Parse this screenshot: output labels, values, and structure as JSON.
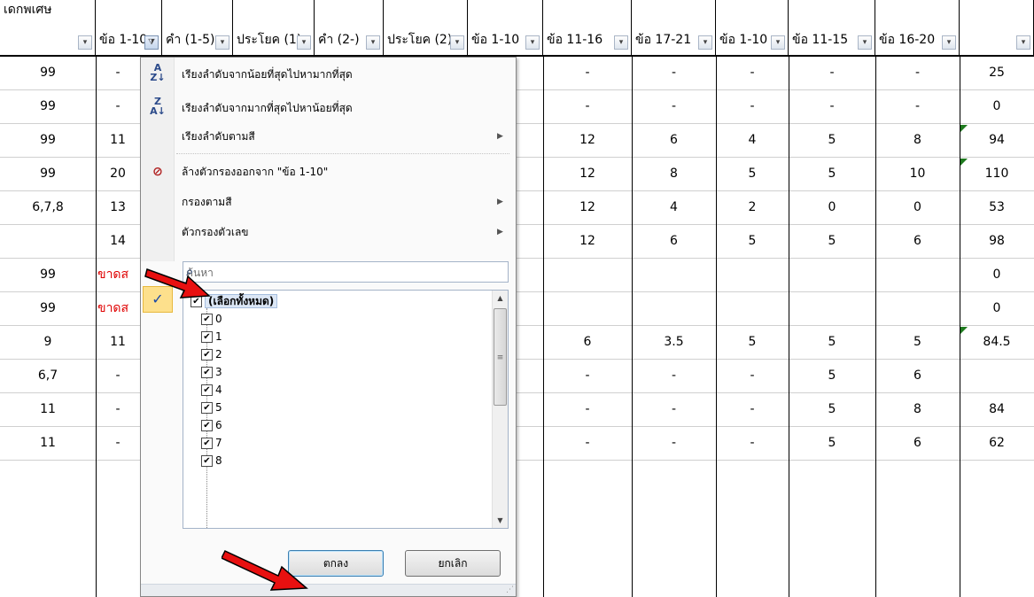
{
  "headers": [
    {
      "label": "เดกพเศษ",
      "dd": true
    },
    {
      "label": "ข้อ 1-10",
      "dd": true,
      "active": true
    },
    {
      "label": "คำ (1-5)",
      "dd": true
    },
    {
      "label": "ประโยค (1)",
      "dd": true
    },
    {
      "label": "คำ (2-)",
      "dd": true
    },
    {
      "label": "ประโยค (2)",
      "dd": true
    },
    {
      "label": "ข้อ 1-10",
      "dd": true
    },
    {
      "label": "ข้อ 11-16",
      "dd": true
    },
    {
      "label": "ข้อ 17-21",
      "dd": true
    },
    {
      "label": "ข้อ 1-10",
      "dd": true
    },
    {
      "label": "ข้อ 11-15",
      "dd": true
    },
    {
      "label": "ข้อ 16-20",
      "dd": true
    },
    {
      "label": "",
      "dd": true
    }
  ],
  "rows": [
    {
      "c0": "99",
      "c1": "-",
      "v": [
        "-",
        "-",
        "-",
        "-",
        "-",
        "25"
      ]
    },
    {
      "c0": "99",
      "c1": "-",
      "v": [
        "-",
        "-",
        "-",
        "-",
        "-",
        "0"
      ]
    },
    {
      "c0": "99",
      "c1": "11",
      "v": [
        "12",
        "6",
        "4",
        "5",
        "8",
        "94"
      ]
    },
    {
      "c0": "99",
      "c1": "20",
      "v": [
        "12",
        "8",
        "5",
        "5",
        "10",
        "110"
      ]
    },
    {
      "c0": "6,7,8",
      "c1": "13",
      "v": [
        "12",
        "4",
        "2",
        "0",
        "0",
        "53"
      ]
    },
    {
      "c0": "",
      "c1": "14",
      "v": [
        "12",
        "6",
        "5",
        "5",
        "6",
        "98"
      ]
    },
    {
      "c0": "99",
      "c1": "ขาดส",
      "v": [
        "",
        "",
        "",
        "",
        "",
        "0"
      ]
    },
    {
      "c0": "99",
      "c1": "ขาดส",
      "v": [
        "",
        "",
        "",
        "",
        "",
        "0"
      ]
    },
    {
      "c0": "9",
      "c1": "11",
      "v": [
        "6",
        "3.5",
        "5",
        "5",
        "5",
        "84.5"
      ]
    },
    {
      "c0": "6,7",
      "c1": "-",
      "v": [
        "-",
        "-",
        "-",
        "5",
        "6",
        ""
      ]
    },
    {
      "c0": "11",
      "c1": "-",
      "v": [
        "-",
        "-",
        "-",
        "5",
        "8",
        "84"
      ]
    },
    {
      "c0": "11",
      "c1": "-",
      "v": [
        "-",
        "-",
        "-",
        "5",
        "6",
        "62"
      ]
    }
  ],
  "menu": {
    "sort_asc": "เรียงลำดับจากน้อยที่สุดไปหามากที่สุด",
    "sort_desc": "เรียงลำดับจากมากที่สุดไปหาน้อยที่สุด",
    "sort_color": "เรียงลำดับตามสี",
    "clear_filter": "ล้างตัวกรองออกจาก \"ข้อ 1-10\"",
    "filter_color": "กรองตามสี",
    "number_filters": "ตัวกรองตัวเลข",
    "search_placeholder": "ค้นหา",
    "select_all": "(เลือกทั้งหมด)",
    "values": [
      "0",
      "1",
      "2",
      "3",
      "4",
      "5",
      "6",
      "7",
      "8"
    ],
    "ok": "ตกลง",
    "cancel": "ยกเลิก"
  }
}
